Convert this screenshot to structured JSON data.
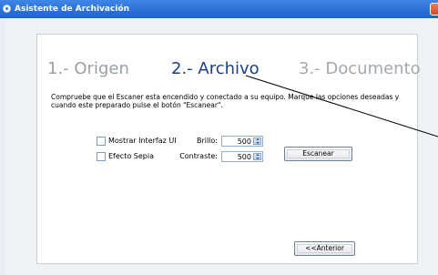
{
  "window": {
    "title": "Asistente de Archivación"
  },
  "steps": [
    {
      "label": "1.- Origen"
    },
    {
      "label": "2.- Archivo"
    },
    {
      "label": "3.- Documento"
    }
  ],
  "description": "Compruebe que el Escaner esta encendido y conectado a su equipo. Marque las opciones deseadas y cuando este preparado pulse el botón \"Escanear\".",
  "options": {
    "mostrar_interfaz": {
      "label": "Mostrar Interfaz UI",
      "checked": false
    },
    "efecto_sepia": {
      "label": "Efecto Sepia",
      "checked": false
    }
  },
  "brillo": {
    "label": "Brillo:",
    "value": "500"
  },
  "contraste": {
    "label": "Contraste:",
    "value": "500"
  },
  "buttons": {
    "escanear": "Escanear",
    "anterior": "<<Anterior"
  }
}
